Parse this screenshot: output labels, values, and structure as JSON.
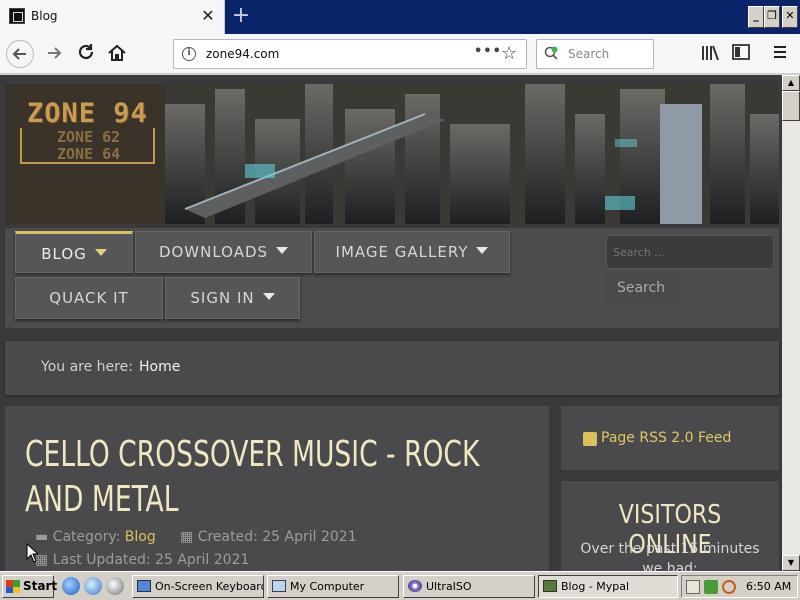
{
  "browser": {
    "tab_title": "Blog",
    "tab_close": "✕",
    "new_tab": "+",
    "url": "zone94.com",
    "url_more": "•••",
    "search_placeholder": "Search"
  },
  "window_controls": {
    "minimize": "_",
    "restore": "❐",
    "close": "✕"
  },
  "site": {
    "logo_main": "ZONE 94",
    "logo_sub1": "ZONE 62",
    "logo_sub2": "ZONE 64",
    "menu": {
      "blog": "BLOG",
      "downloads": "DOWNLOADS",
      "image_gallery": "IMAGE GALLERY",
      "quack_it": "QUACK IT",
      "sign_in": "SIGN IN"
    },
    "search_placeholder": "Search ...",
    "search_button": "Search",
    "breadcrumb_label": "You are here:",
    "breadcrumb_home": "Home",
    "article": {
      "title": "CELLO CROSSOVER MUSIC - ROCK AND METAL",
      "category_label": "Category:",
      "category": "Blog",
      "created": "Created: 25 April 2021",
      "updated": "Last Updated: 25 April 2021"
    },
    "rss": "Page RSS 2.0 Feed",
    "visitors_title": "VISITORS ONLINE",
    "visitors_line1": "Over the past 15 minutes",
    "visitors_line2": "we had:"
  },
  "taskbar": {
    "start": "Start",
    "tasks": [
      "On-Screen Keyboard",
      "My Computer",
      "UltraISO",
      "Blog - Mypal"
    ],
    "clock": "6:50 AM"
  }
}
